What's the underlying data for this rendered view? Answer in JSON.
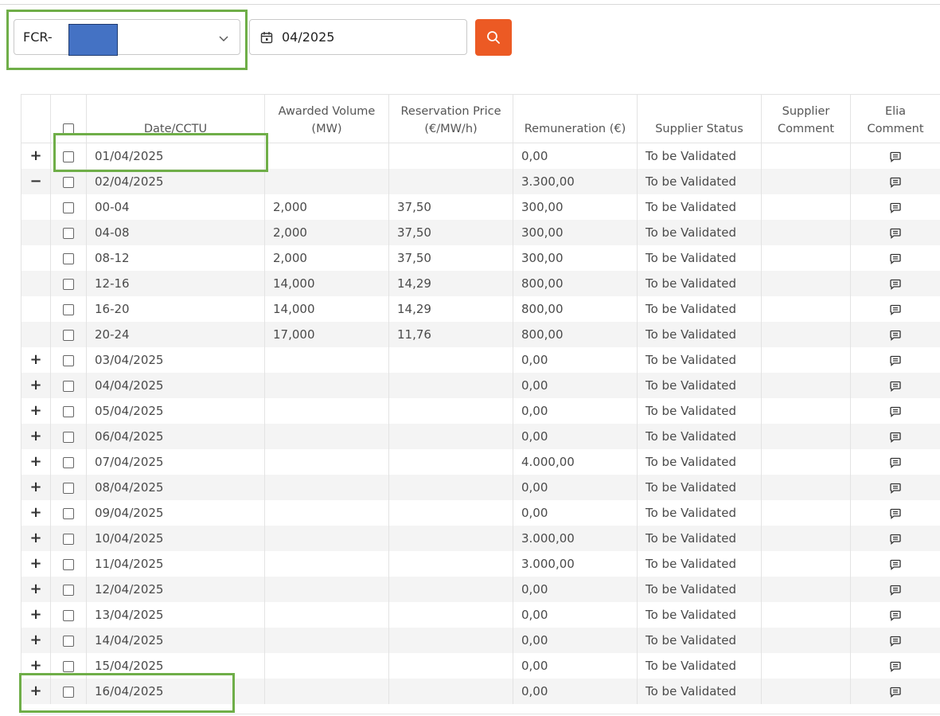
{
  "filters": {
    "select_value": "FCR-",
    "date_value": "04/2025"
  },
  "table": {
    "headers": {
      "date": "Date/CCTU",
      "awarded_volume": "Awarded Volume (MW)",
      "reservation_price": "Reservation Price (€/MW/h)",
      "remuneration": "Remuneration (€)",
      "supplier_status": "Supplier Status",
      "supplier_comment": "Supplier Comment",
      "elia_comment": "Elia Comment"
    },
    "rows": [
      {
        "expander": "+",
        "date": "01/04/2025",
        "volume": "",
        "price": "",
        "remuneration": "0,00",
        "status": "To be Validated",
        "supplier_comment": ""
      },
      {
        "expander": "−",
        "date": "02/04/2025",
        "volume": "",
        "price": "",
        "remuneration": "3.300,00",
        "status": "To be Validated",
        "supplier_comment": ""
      },
      {
        "expander": "",
        "date": "00-04",
        "volume": "2,000",
        "price": "37,50",
        "remuneration": "300,00",
        "status": "To be Validated",
        "supplier_comment": ""
      },
      {
        "expander": "",
        "date": "04-08",
        "volume": "2,000",
        "price": "37,50",
        "remuneration": "300,00",
        "status": "To be Validated",
        "supplier_comment": ""
      },
      {
        "expander": "",
        "date": "08-12",
        "volume": "2,000",
        "price": "37,50",
        "remuneration": "300,00",
        "status": "To be Validated",
        "supplier_comment": ""
      },
      {
        "expander": "",
        "date": "12-16",
        "volume": "14,000",
        "price": "14,29",
        "remuneration": "800,00",
        "status": "To be Validated",
        "supplier_comment": ""
      },
      {
        "expander": "",
        "date": "16-20",
        "volume": "14,000",
        "price": "14,29",
        "remuneration": "800,00",
        "status": "To be Validated",
        "supplier_comment": ""
      },
      {
        "expander": "",
        "date": "20-24",
        "volume": "17,000",
        "price": "11,76",
        "remuneration": "800,00",
        "status": "To be Validated",
        "supplier_comment": ""
      },
      {
        "expander": "+",
        "date": "03/04/2025",
        "volume": "",
        "price": "",
        "remuneration": "0,00",
        "status": "To be Validated",
        "supplier_comment": ""
      },
      {
        "expander": "+",
        "date": "04/04/2025",
        "volume": "",
        "price": "",
        "remuneration": "0,00",
        "status": "To be Validated",
        "supplier_comment": ""
      },
      {
        "expander": "+",
        "date": "05/04/2025",
        "volume": "",
        "price": "",
        "remuneration": "0,00",
        "status": "To be Validated",
        "supplier_comment": ""
      },
      {
        "expander": "+",
        "date": "06/04/2025",
        "volume": "",
        "price": "",
        "remuneration": "0,00",
        "status": "To be Validated",
        "supplier_comment": ""
      },
      {
        "expander": "+",
        "date": "07/04/2025",
        "volume": "",
        "price": "",
        "remuneration": "4.000,00",
        "status": "To be Validated",
        "supplier_comment": ""
      },
      {
        "expander": "+",
        "date": "08/04/2025",
        "volume": "",
        "price": "",
        "remuneration": "0,00",
        "status": "To be Validated",
        "supplier_comment": ""
      },
      {
        "expander": "+",
        "date": "09/04/2025",
        "volume": "",
        "price": "",
        "remuneration": "0,00",
        "status": "To be Validated",
        "supplier_comment": ""
      },
      {
        "expander": "+",
        "date": "10/04/2025",
        "volume": "",
        "price": "",
        "remuneration": "3.000,00",
        "status": "To be Validated",
        "supplier_comment": ""
      },
      {
        "expander": "+",
        "date": "11/04/2025",
        "volume": "",
        "price": "",
        "remuneration": "3.000,00",
        "status": "To be Validated",
        "supplier_comment": ""
      },
      {
        "expander": "+",
        "date": "12/04/2025",
        "volume": "",
        "price": "",
        "remuneration": "0,00",
        "status": "To be Validated",
        "supplier_comment": ""
      },
      {
        "expander": "+",
        "date": "13/04/2025",
        "volume": "",
        "price": "",
        "remuneration": "0,00",
        "status": "To be Validated",
        "supplier_comment": ""
      },
      {
        "expander": "+",
        "date": "14/04/2025",
        "volume": "",
        "price": "",
        "remuneration": "0,00",
        "status": "To be Validated",
        "supplier_comment": ""
      },
      {
        "expander": "+",
        "date": "15/04/2025",
        "volume": "",
        "price": "",
        "remuneration": "0,00",
        "status": "To be Validated",
        "supplier_comment": ""
      },
      {
        "expander": "+",
        "date": "16/04/2025",
        "volume": "",
        "price": "",
        "remuneration": "0,00",
        "status": "To be Validated",
        "supplier_comment": ""
      }
    ]
  },
  "icons": {
    "select_chevron": "chevron-down-icon",
    "date": "calendar-icon",
    "search": "search-icon",
    "comment": "comment-icon"
  },
  "colors": {
    "search_button": "#ec5a24",
    "highlight": "#6fae48",
    "redaction": "#4472c4",
    "row_stripe": "#f4f4f4"
  }
}
